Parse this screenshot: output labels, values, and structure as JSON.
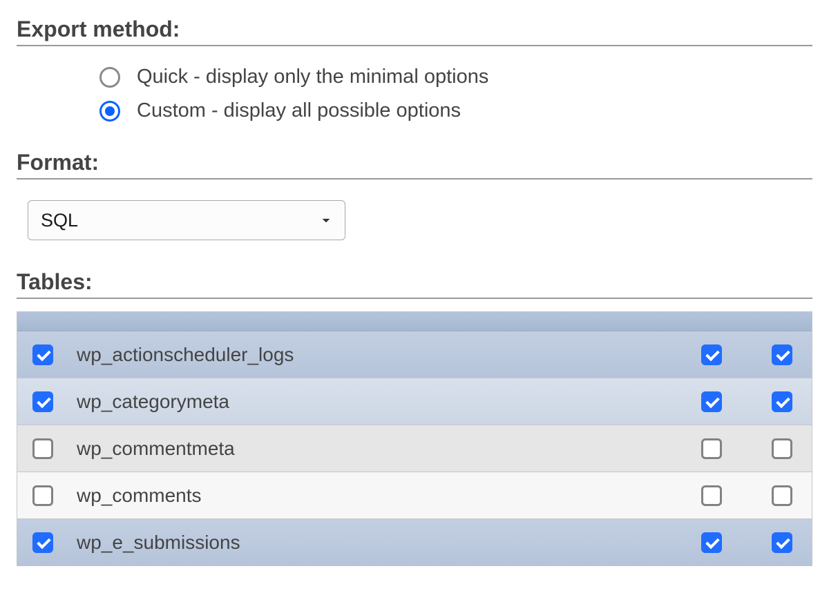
{
  "export_method": {
    "heading": "Export method:",
    "options": [
      {
        "label": "Quick - display only the minimal options",
        "selected": false
      },
      {
        "label": "Custom - display all possible options",
        "selected": true
      }
    ]
  },
  "format": {
    "heading": "Format:",
    "selected": "SQL"
  },
  "tables": {
    "heading": "Tables:",
    "rows": [
      {
        "name": "wp_actionscheduler_logs",
        "checked_left": true,
        "checked_r1": true,
        "checked_r2": true,
        "row_style": "selected-even"
      },
      {
        "name": "wp_categorymeta",
        "checked_left": true,
        "checked_r1": true,
        "checked_r2": true,
        "row_style": "selected-odd"
      },
      {
        "name": "wp_commentmeta",
        "checked_left": false,
        "checked_r1": false,
        "checked_r2": false,
        "row_style": "unselected-even"
      },
      {
        "name": "wp_comments",
        "checked_left": false,
        "checked_r1": false,
        "checked_r2": false,
        "row_style": "unselected-odd"
      },
      {
        "name": "wp_e_submissions",
        "checked_left": true,
        "checked_r1": true,
        "checked_r2": true,
        "row_style": "selected-even"
      }
    ]
  }
}
